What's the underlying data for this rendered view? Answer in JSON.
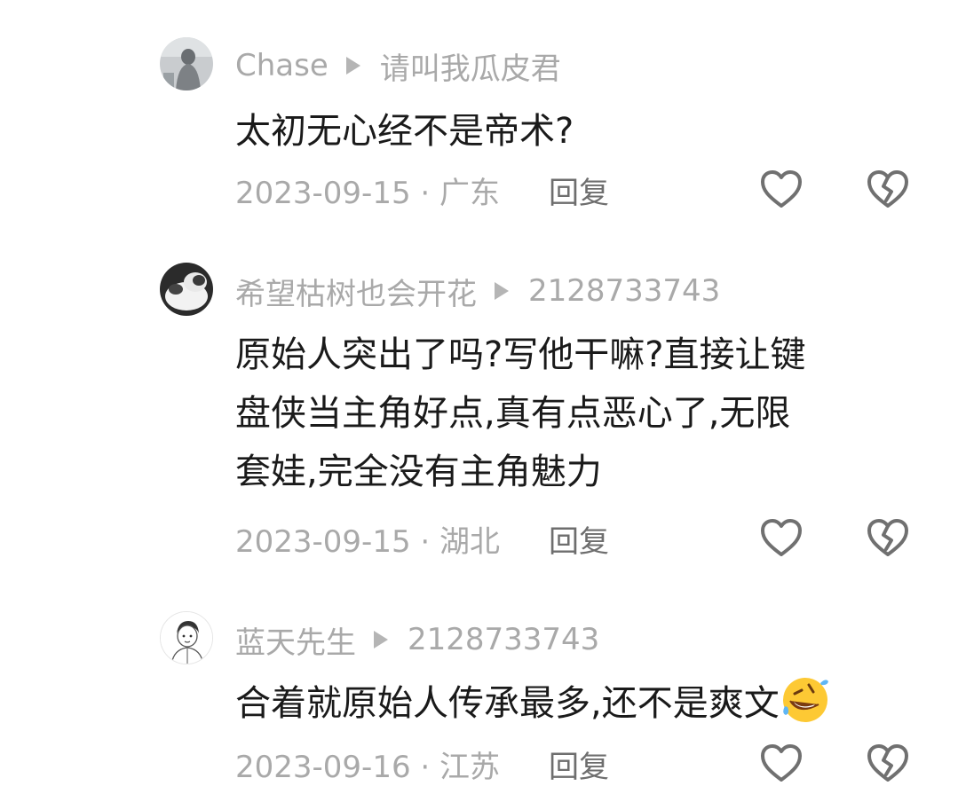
{
  "comments": [
    {
      "user": "Chase",
      "reply_to": "请叫我瓜皮君",
      "text_lines": [
        "太初无心经不是帝术?"
      ],
      "date_location": "2023-09-15 · 广东",
      "reply_label": "回复",
      "avatar_icon": "gray-figure-avatar"
    },
    {
      "user": "希望枯树也会开花",
      "reply_to": "2128733743",
      "text_lines": [
        "原始人突出了吗?写他干嘛?直接让键",
        "盘侠当主角好点,真有点恶心了,无限",
        "套娃,完全没有主角魅力"
      ],
      "date_location": "2023-09-15 · 湖北",
      "reply_label": "回复",
      "avatar_icon": "cat-avatar"
    },
    {
      "user": "蓝天先生",
      "reply_to": "2128733743",
      "text_lines": [
        "合着就原始人传承最多,还不是爽文"
      ],
      "date_location": "2023-09-16 · 江苏",
      "reply_label": "回复",
      "avatar_icon": "cartoon-boy-avatar",
      "trailing_emoji": "rofl-emoji"
    }
  ],
  "icons": {
    "like": "heart-outline-icon",
    "dislike": "broken-heart-outline-icon"
  },
  "colors": {
    "meta_text": "#a9a9a9",
    "body_text": "#1a1a1a",
    "icon_stroke": "#707070"
  }
}
